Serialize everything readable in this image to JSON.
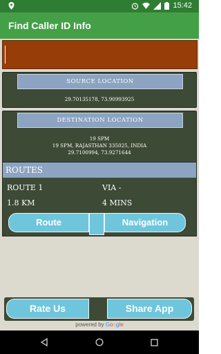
{
  "status_bar": {
    "time": "15:42",
    "icons": [
      "alarm-icon",
      "wifi-icon",
      "signal-icon",
      "battery-icon"
    ],
    "notification_icon": "location-pin-icon"
  },
  "app_bar": {
    "title": "Find Caller ID Info"
  },
  "search": {
    "value": ""
  },
  "source": {
    "header": "SOURCE LOCATION",
    "coords": "29.70135178, 73.90993925"
  },
  "destination": {
    "header": "DESTINATION LOCATION",
    "line1": "19 SPM",
    "line2": "19 SPM, RAJASTHAN 335025, INDIA",
    "line3": "29.7100994, 73.9271644"
  },
  "routes": {
    "header": "ROUTES",
    "route_label": "ROUTE 1",
    "via_label": "VIA -",
    "distance": "1.8 KM",
    "duration": "4 MINS",
    "route_button": "Route",
    "navigation_button": "Navigation"
  },
  "actions": {
    "rate_button": "Rate Us",
    "share_button": "Share App"
  },
  "footer": {
    "powered_prefix": "powered by ",
    "brand": [
      "G",
      "o",
      "o",
      "g",
      "l",
      "e"
    ]
  },
  "colors": {
    "status_bar": "#2f7d32",
    "app_bar": "#44a047",
    "search_bar": "#973d08",
    "card": "#3d4a36",
    "header_blue": "#8ca4c1",
    "button": "#6fc6dc"
  }
}
